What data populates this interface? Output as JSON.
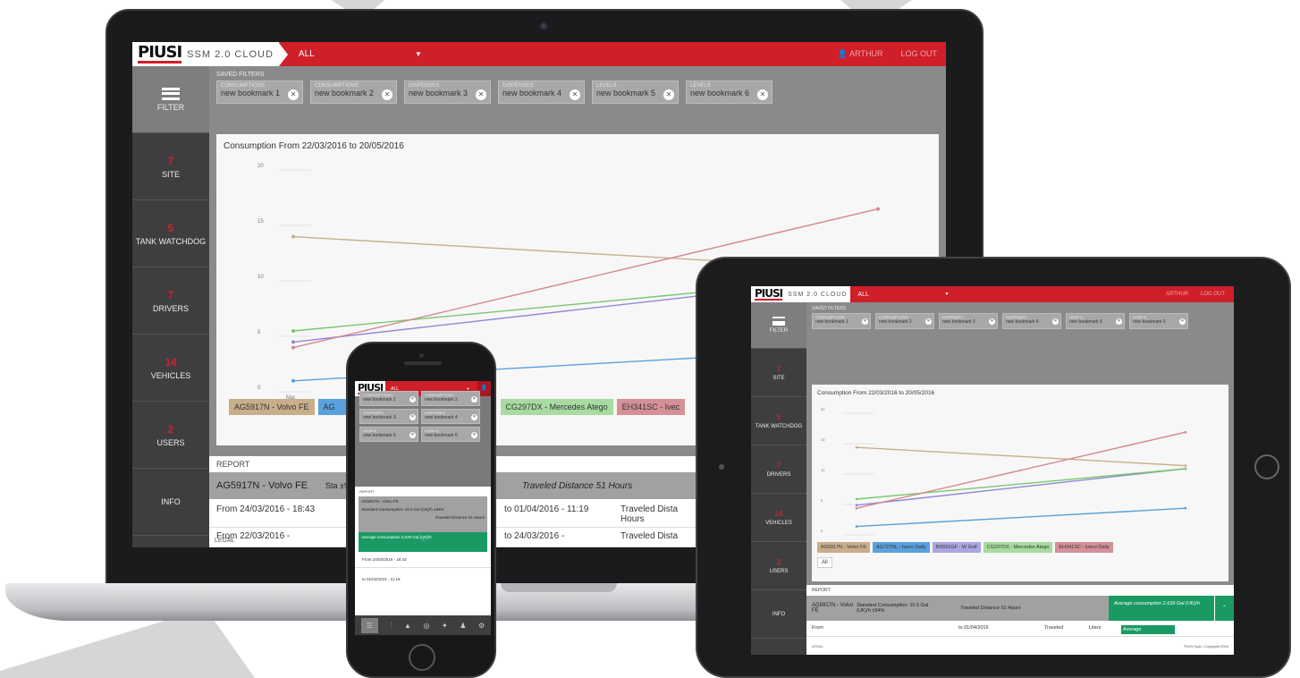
{
  "colors": {
    "brand_red": "#cf1f29",
    "sidebar": "#3e3e40",
    "accent_green": "#1a9a63"
  },
  "app": {
    "logo": "PIUSI",
    "product": "SSM 2.0 CLOUD",
    "selector": "ALL",
    "user": "ARTHUR",
    "logout": "LOG OUT"
  },
  "sidebar": {
    "filter_label": "FILTER",
    "items": [
      {
        "count": "7",
        "label": "SITE"
      },
      {
        "count": "5",
        "label": "TANK WATCHDOG"
      },
      {
        "count": "7",
        "label": "DRIVERS"
      },
      {
        "count": "14",
        "label": "VEHICLES"
      },
      {
        "count": "2",
        "label": "USERS"
      },
      {
        "count": "",
        "label": "INFO"
      }
    ]
  },
  "saved_filters": {
    "title": "SAVED FILTERS",
    "chips": [
      {
        "category": "CONSUMPTIONS",
        "name": "new bookmark 1"
      },
      {
        "category": "CONSUMPTIONS",
        "name": "new bookmark 2"
      },
      {
        "category": "DISPENSES",
        "name": "new bookmark 3"
      },
      {
        "category": "DISPENSES",
        "name": "new bookmark 4"
      },
      {
        "category": "LEVELS",
        "name": "new bookmark 5"
      },
      {
        "category": "LEVELS",
        "name": "new bookmark 6"
      }
    ]
  },
  "chart_data": {
    "type": "line",
    "title": "Consumption From 22/03/2016 to 20/05/2016",
    "x": [
      "Mar",
      "May"
    ],
    "ylim": [
      0,
      20
    ],
    "yticks": [
      "20",
      "15",
      "10",
      "5",
      "0"
    ],
    "series": [
      {
        "name": "AG5917N - Volvo FE",
        "color": "#c9ae8c",
        "values": [
          13.5,
          10.5
        ]
      },
      {
        "name": "AG727NL - Iveco Daily",
        "color": "#5aa0dc",
        "values": [
          0.5,
          3.5
        ]
      },
      {
        "name": "BS591GF - W Golf",
        "color": "#8f88d6",
        "values": [
          4,
          10
        ]
      },
      {
        "name": "CG297DX - Mercedes Atego",
        "color": "#78c86e",
        "values": [
          5,
          10
        ]
      },
      {
        "name": "EH341SC - Iveco Daily",
        "color": "#d4888f",
        "values": [
          3.5,
          16
        ]
      }
    ],
    "legend_fill": [
      "#c9ae8c",
      "#5aa0dc",
      "#a9a6e0",
      "#a7dba0",
      "#d49096"
    ]
  },
  "laptop_legend": [
    "AG5917N - Volvo FE",
    "AG",
    "CG297DX - Mercedes Atego",
    "EH341SC - Ivec"
  ],
  "report": {
    "title": "REPORT",
    "vehicle": "AG5917N - Volvo FE",
    "col_standard": "Sta ±9",
    "distance": "Traveled Distance 51 Hours",
    "rows": [
      {
        "from": "From 24/03/2016 - 18:43",
        "to": "to 01/04/2016 - 11:19",
        "dist": "Traveled Dista Hours"
      },
      {
        "from": "From 22/03/2016 -",
        "to": "to 24/03/2016 -",
        "dist": "Traveled Dista"
      }
    ],
    "legal": "LEGAL"
  },
  "tablet": {
    "legend": [
      "AG5917N - Volvo FE",
      "AG727NL - Iveco Daily",
      "BS591GF - W Golf",
      "CG297DX - Mercedes Atego",
      "EH341SC - Iveco Daily"
    ],
    "all_button": "All",
    "report_vehicle": "AG5917N - Volvo FE",
    "standard_label": "Standard",
    "standard_value": "Consumption: 15.5 Gal (UK)/h ±94%",
    "distance": "Traveled Distance 51 Hours",
    "avg_label": "Average consumption 2,639 Gal (UK)/h",
    "row_from": "From",
    "row_to": "to 01/04/2016",
    "row_traveled": "Traveled",
    "row_liters": "Liters",
    "row_avg": "Average",
    "legal": "LEGAL",
    "copyright": "PIUSI SpA • Copyright 2016"
  },
  "phone": {
    "selector": "ALL",
    "report_title": "REPORT",
    "vehicle": "AG5917N - Volvo FE",
    "standard": "Standard Consumption: 15.5 Gal (UK)/h ±94%",
    "distance": "Traveled Distance 51 Hours",
    "avg": "Average consumption 2,639 Gal (UK)/h",
    "from": "From 24/03/2016 - 18:43",
    "to": "to 01/04/2016 - 11:19"
  }
}
